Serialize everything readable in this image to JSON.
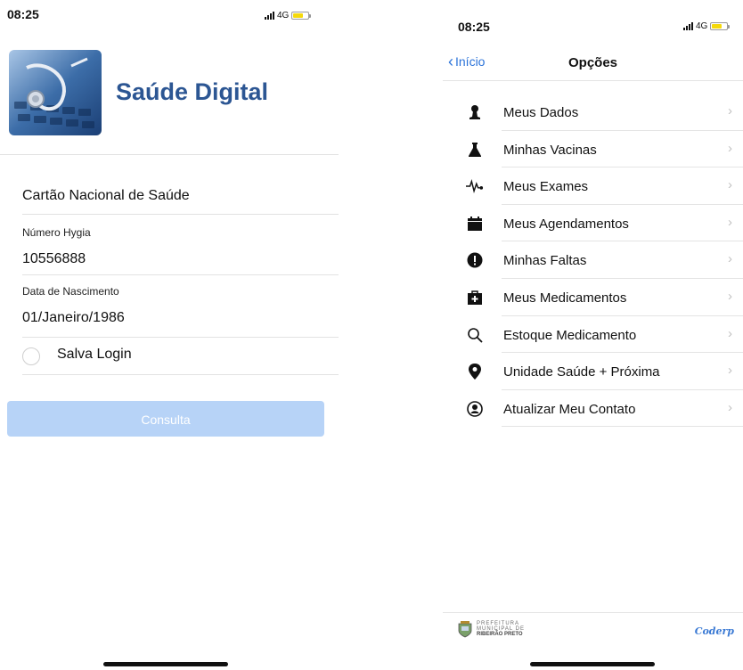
{
  "left": {
    "status": {
      "time": "08:25",
      "network": "4G"
    },
    "app_title": "Saúde Digital",
    "card_label": "Cartão Nacional de Saúde",
    "hygia_label": "Número Hygia",
    "hygia_value": "10556888",
    "birth_label": "Data de Nascimento",
    "birth_value": "01/Janeiro/1986",
    "save_login_label": "Salva Login",
    "consulta_label": "Consulta"
  },
  "right": {
    "status": {
      "time": "08:25",
      "network": "4G"
    },
    "back_label": "Início",
    "title": "Opções",
    "menu": [
      {
        "label": "Meus Dados",
        "icon": "person-icon"
      },
      {
        "label": "Minhas Vacinas",
        "icon": "flask-icon"
      },
      {
        "label": "Meus Exames",
        "icon": "heartbeat-icon"
      },
      {
        "label": "Meus Agendamentos",
        "icon": "calendar-icon"
      },
      {
        "label": "Minhas Faltas",
        "icon": "alert-icon"
      },
      {
        "label": "Meus Medicamentos",
        "icon": "medical-kit-icon"
      },
      {
        "label": "Estoque Medicamento",
        "icon": "search-icon"
      },
      {
        "label": "Unidade Saúde + Próxima",
        "icon": "location-pin-icon"
      },
      {
        "label": "Atualizar Meu Contato",
        "icon": "contact-icon"
      }
    ],
    "footer": {
      "prefeitura_line1": "PREFEITURA",
      "prefeitura_line2": "MUNICIPAL DE",
      "prefeitura_line3": "RIBEIRÃO PRETO",
      "coderp_label": "Coderp"
    }
  },
  "colors": {
    "accent": "#2b73d9",
    "title_blue": "#2c5693",
    "button_disabled": "#b7d3f7",
    "battery": "#f5d90b"
  }
}
